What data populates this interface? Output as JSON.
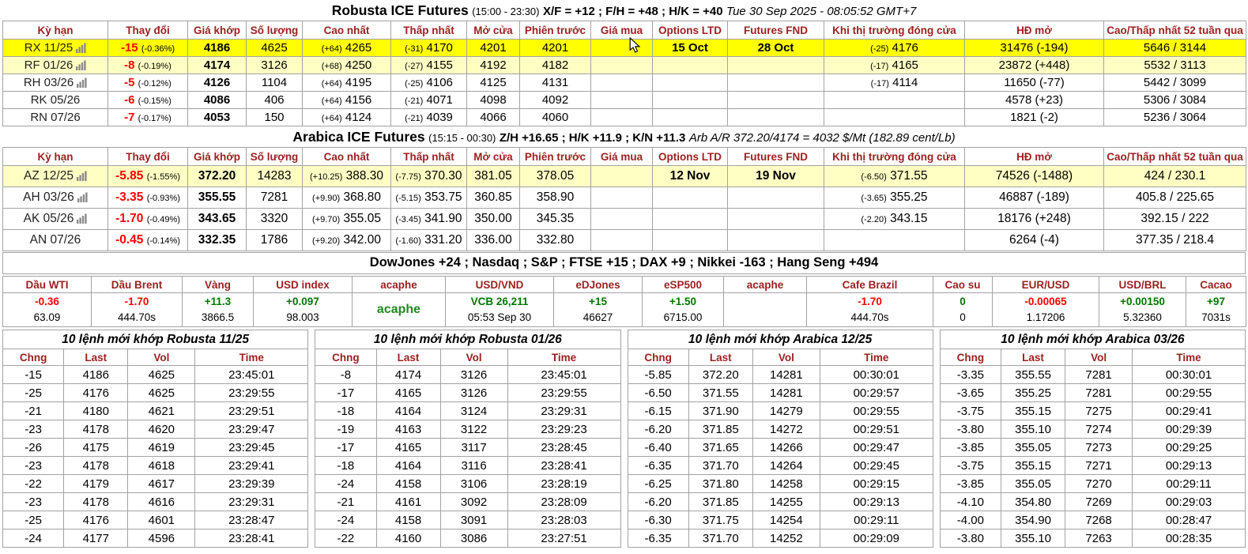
{
  "colors": {
    "header_red": "#9e2020",
    "down_red": "#ff0000",
    "up_green": "#007800",
    "brand_green": "#1e8a1e",
    "highlight_bright": "#ffff00",
    "highlight_pale": "#ffffc4"
  },
  "futures_headers": [
    "Kỳ hạn",
    "Thay đổi",
    "Giá khớp",
    "Số lượng",
    "Cao nhất",
    "Thấp nhất",
    "Mở cửa",
    "Phiên trước",
    "Giá mua",
    "Options LTD",
    "Futures FND",
    "Khi thị trường đóng cửa",
    "HĐ mở",
    "Cao/Thấp nhất 52 tuần qua"
  ],
  "robusta": {
    "title": "Robusta ICE Futures",
    "session": "(15:00 - 23:30)",
    "spreads": "X/F = +12 ; F/H = +48 ; H/K = +40",
    "datetime": "Tue 30 Sep 2025 - 08:05:52 GMT+7",
    "rows": [
      {
        "contract": "RX 11/25",
        "chart_icon": true,
        "row_class": "hl-bright",
        "change": "-15",
        "change_pct": "(-0.36%)",
        "last": "4186",
        "volume": "4625",
        "high_d": "(+64)",
        "high": "4265",
        "low_d": "(-31)",
        "low": "4170",
        "open": "4201",
        "prev": "4201",
        "bid": "",
        "opt_ltd": "15 Oct",
        "fut_fnd": "28 Oct",
        "close_d": "(-25)",
        "close": "4176",
        "oi": "31476 (-194)",
        "hl52": "5646 / 3144"
      },
      {
        "contract": "RF 01/26",
        "chart_icon": true,
        "row_class": "hl-pale",
        "change": "-8",
        "change_pct": "(-0.19%)",
        "last": "4174",
        "volume": "3126",
        "high_d": "(+68)",
        "high": "4250",
        "low_d": "(-27)",
        "low": "4155",
        "open": "4192",
        "prev": "4182",
        "bid": "",
        "opt_ltd": "",
        "fut_fnd": "",
        "close_d": "(-17)",
        "close": "4165",
        "oi": "23872 (+448)",
        "hl52": "5532 / 3113"
      },
      {
        "contract": "RH 03/26",
        "chart_icon": true,
        "row_class": "",
        "change": "-5",
        "change_pct": "(-0.12%)",
        "last": "4126",
        "volume": "1104",
        "high_d": "(+64)",
        "high": "4195",
        "low_d": "(-25)",
        "low": "4106",
        "open": "4125",
        "prev": "4131",
        "bid": "",
        "opt_ltd": "",
        "fut_fnd": "",
        "close_d": "(-17)",
        "close": "4114",
        "oi": "11650 (-77)",
        "hl52": "5442 / 3099"
      },
      {
        "contract": "RK 05/26",
        "chart_icon": false,
        "row_class": "",
        "change": "-6",
        "change_pct": "(-0.15%)",
        "last": "4086",
        "volume": "406",
        "high_d": "(+64)",
        "high": "4156",
        "low_d": "(-21)",
        "low": "4071",
        "open": "4098",
        "prev": "4092",
        "bid": "",
        "opt_ltd": "",
        "fut_fnd": "",
        "close_d": "",
        "close": "",
        "oi": "4578 (+23)",
        "hl52": "5306 / 3084"
      },
      {
        "contract": "RN 07/26",
        "chart_icon": false,
        "row_class": "",
        "change": "-7",
        "change_pct": "(-0.17%)",
        "last": "4053",
        "volume": "150",
        "high_d": "(+64)",
        "high": "4124",
        "low_d": "(-21)",
        "low": "4039",
        "open": "4066",
        "prev": "4060",
        "bid": "",
        "opt_ltd": "",
        "fut_fnd": "",
        "close_d": "",
        "close": "",
        "oi": "1821 (-2)",
        "hl52": "5236 / 3064"
      }
    ]
  },
  "arabica": {
    "title": "Arabica ICE Futures",
    "session": "(15:15 - 00:30)",
    "spreads": "Z/H +16.65 ; H/K +11.9 ; K/N +11.3",
    "arbitrage": "Arb A/R 372.20/4174 = 4032 $/Mt (182.89 cent/Lb)",
    "rows": [
      {
        "contract": "AZ 12/25",
        "chart_icon": true,
        "row_class": "hl-pale",
        "change": "-5.85",
        "change_pct": "(-1.55%)",
        "last": "372.20",
        "volume": "14283",
        "high_d": "(+10.25)",
        "high": "388.30",
        "low_d": "(-7.75)",
        "low": "370.30",
        "open": "381.05",
        "prev": "378.05",
        "bid": "",
        "opt_ltd": "12 Nov",
        "fut_fnd": "19 Nov",
        "close_d": "(-6.50)",
        "close": "371.55",
        "oi": "74526 (-1488)",
        "hl52": "424 / 230.1"
      },
      {
        "contract": "AH 03/26",
        "chart_icon": true,
        "row_class": "",
        "change": "-3.35",
        "change_pct": "(-0.93%)",
        "last": "355.55",
        "volume": "7281",
        "high_d": "(+9.90)",
        "high": "368.80",
        "low_d": "(-5.15)",
        "low": "353.75",
        "open": "360.85",
        "prev": "358.90",
        "bid": "",
        "opt_ltd": "",
        "fut_fnd": "",
        "close_d": "(-3.65)",
        "close": "355.25",
        "oi": "46887 (-189)",
        "hl52": "405.8 / 225.65"
      },
      {
        "contract": "AK 05/26",
        "chart_icon": true,
        "row_class": "",
        "change": "-1.70",
        "change_pct": "(-0.49%)",
        "last": "343.65",
        "volume": "3320",
        "high_d": "(+9.70)",
        "high": "355.05",
        "low_d": "(-3.45)",
        "low": "341.90",
        "open": "350.00",
        "prev": "345.35",
        "bid": "",
        "opt_ltd": "",
        "fut_fnd": "",
        "close_d": "(-2.20)",
        "close": "343.15",
        "oi": "18176 (+248)",
        "hl52": "392.15 / 222"
      },
      {
        "contract": "AN 07/26",
        "chart_icon": false,
        "row_class": "",
        "change": "-0.45",
        "change_pct": "(-0.14%)",
        "last": "332.35",
        "volume": "1786",
        "high_d": "(+9.20)",
        "high": "342.00",
        "low_d": "(-1.60)",
        "low": "331.20",
        "open": "336.00",
        "prev": "332.80",
        "bid": "",
        "opt_ltd": "",
        "fut_fnd": "",
        "close_d": "",
        "close": "",
        "oi": "6264 (-4)",
        "hl52": "377.35 / 218.4"
      }
    ]
  },
  "indices_line": "DowJones +24 ; Nasdaq ; S&P ; FTSE +15 ; DAX +9 ; Nikkei -163 ; Hang Seng +494",
  "market": {
    "columns": [
      {
        "label": "Dầu WTI",
        "change": "-0.36",
        "change_class": "down",
        "value": "63.09"
      },
      {
        "label": "Dầu Brent",
        "change": "-1.70",
        "change_class": "down",
        "value": "444.70s"
      },
      {
        "label": "Vàng",
        "change": "+11.3",
        "change_class": "up",
        "value": "3866.5"
      },
      {
        "label": "USD index",
        "change": "+0.097",
        "change_class": "up",
        "value": "98.003"
      },
      {
        "label": "acaphe",
        "change": "acaphe",
        "change_class": "brand",
        "value": ""
      },
      {
        "label": "USD/VND",
        "change": "VCB 26,211",
        "change_class": "up",
        "value": "05:53 Sep 30"
      },
      {
        "label": "eDJones",
        "change": "+15",
        "change_class": "up",
        "value": "46627"
      },
      {
        "label": "eSP500",
        "change": "+1.50",
        "change_class": "up",
        "value": "6715.00"
      },
      {
        "label": "acaphe",
        "change": "",
        "change_class": "",
        "value": ""
      },
      {
        "label": "Cafe Brazil",
        "change": "-1.70",
        "change_class": "down",
        "value": "444.70s"
      },
      {
        "label": "Cao su",
        "change": "0",
        "change_class": "up",
        "value": "0"
      },
      {
        "label": "EUR/USD",
        "change": "-0.00065",
        "change_class": "down",
        "value": "1.17206"
      },
      {
        "label": "USD/BRL",
        "change": "+0.00150",
        "change_class": "up",
        "value": "5.32360"
      },
      {
        "label": "Cacao",
        "change": "+97",
        "change_class": "up",
        "value": "7031s"
      }
    ]
  },
  "order_headers": [
    "Chng",
    "Last",
    "Vol",
    "Time"
  ],
  "order_tables": [
    {
      "title": "10 lệnh mới khớp Robusta 11/25",
      "rows": [
        [
          "-15",
          "4186",
          "4625",
          "23:45:01"
        ],
        [
          "-25",
          "4176",
          "4625",
          "23:29:55"
        ],
        [
          "-21",
          "4180",
          "4621",
          "23:29:51"
        ],
        [
          "-23",
          "4178",
          "4620",
          "23:29:47"
        ],
        [
          "-26",
          "4175",
          "4619",
          "23:29:45"
        ],
        [
          "-23",
          "4178",
          "4618",
          "23:29:41"
        ],
        [
          "-22",
          "4179",
          "4617",
          "23:29:39"
        ],
        [
          "-23",
          "4178",
          "4616",
          "23:29:31"
        ],
        [
          "-25",
          "4176",
          "4601",
          "23:28:47"
        ],
        [
          "-24",
          "4177",
          "4596",
          "23:28:41"
        ]
      ]
    },
    {
      "title": "10 lệnh mới khớp Robusta 01/26",
      "rows": [
        [
          "-8",
          "4174",
          "3126",
          "23:45:01"
        ],
        [
          "-17",
          "4165",
          "3126",
          "23:29:55"
        ],
        [
          "-18",
          "4164",
          "3124",
          "23:29:31"
        ],
        [
          "-19",
          "4163",
          "3122",
          "23:29:23"
        ],
        [
          "-17",
          "4165",
          "3117",
          "23:28:45"
        ],
        [
          "-18",
          "4164",
          "3116",
          "23:28:41"
        ],
        [
          "-24",
          "4158",
          "3106",
          "23:28:19"
        ],
        [
          "-21",
          "4161",
          "3092",
          "23:28:09"
        ],
        [
          "-24",
          "4158",
          "3091",
          "23:28:03"
        ],
        [
          "-22",
          "4160",
          "3086",
          "23:27:51"
        ]
      ]
    },
    {
      "title": "10 lệnh mới khớp Arabica 12/25",
      "rows": [
        [
          "-5.85",
          "372.20",
          "14281",
          "00:30:01"
        ],
        [
          "-6.50",
          "371.55",
          "14281",
          "00:29:57"
        ],
        [
          "-6.15",
          "371.90",
          "14279",
          "00:29:55"
        ],
        [
          "-6.20",
          "371.85",
          "14272",
          "00:29:51"
        ],
        [
          "-6.40",
          "371.65",
          "14266",
          "00:29:47"
        ],
        [
          "-6.35",
          "371.70",
          "14264",
          "00:29:45"
        ],
        [
          "-6.25",
          "371.80",
          "14258",
          "00:29:15"
        ],
        [
          "-6.20",
          "371.85",
          "14255",
          "00:29:13"
        ],
        [
          "-6.30",
          "371.75",
          "14254",
          "00:29:11"
        ],
        [
          "-6.35",
          "371.70",
          "14252",
          "00:29:09"
        ]
      ]
    },
    {
      "title": "10 lệnh mới khớp Arabica 03/26",
      "rows": [
        [
          "-3.35",
          "355.55",
          "7281",
          "00:30:01"
        ],
        [
          "-3.65",
          "355.25",
          "7281",
          "00:29:55"
        ],
        [
          "-3.75",
          "355.15",
          "7275",
          "00:29:41"
        ],
        [
          "-3.80",
          "355.10",
          "7274",
          "00:29:39"
        ],
        [
          "-3.85",
          "355.05",
          "7273",
          "00:29:25"
        ],
        [
          "-3.75",
          "355.15",
          "7271",
          "00:29:13"
        ],
        [
          "-3.85",
          "355.05",
          "7270",
          "00:29:11"
        ],
        [
          "-4.10",
          "354.80",
          "7269",
          "00:29:03"
        ],
        [
          "-4.00",
          "354.90",
          "7268",
          "00:28:47"
        ],
        [
          "-3.80",
          "355.10",
          "7263",
          "00:28:35"
        ]
      ]
    }
  ]
}
